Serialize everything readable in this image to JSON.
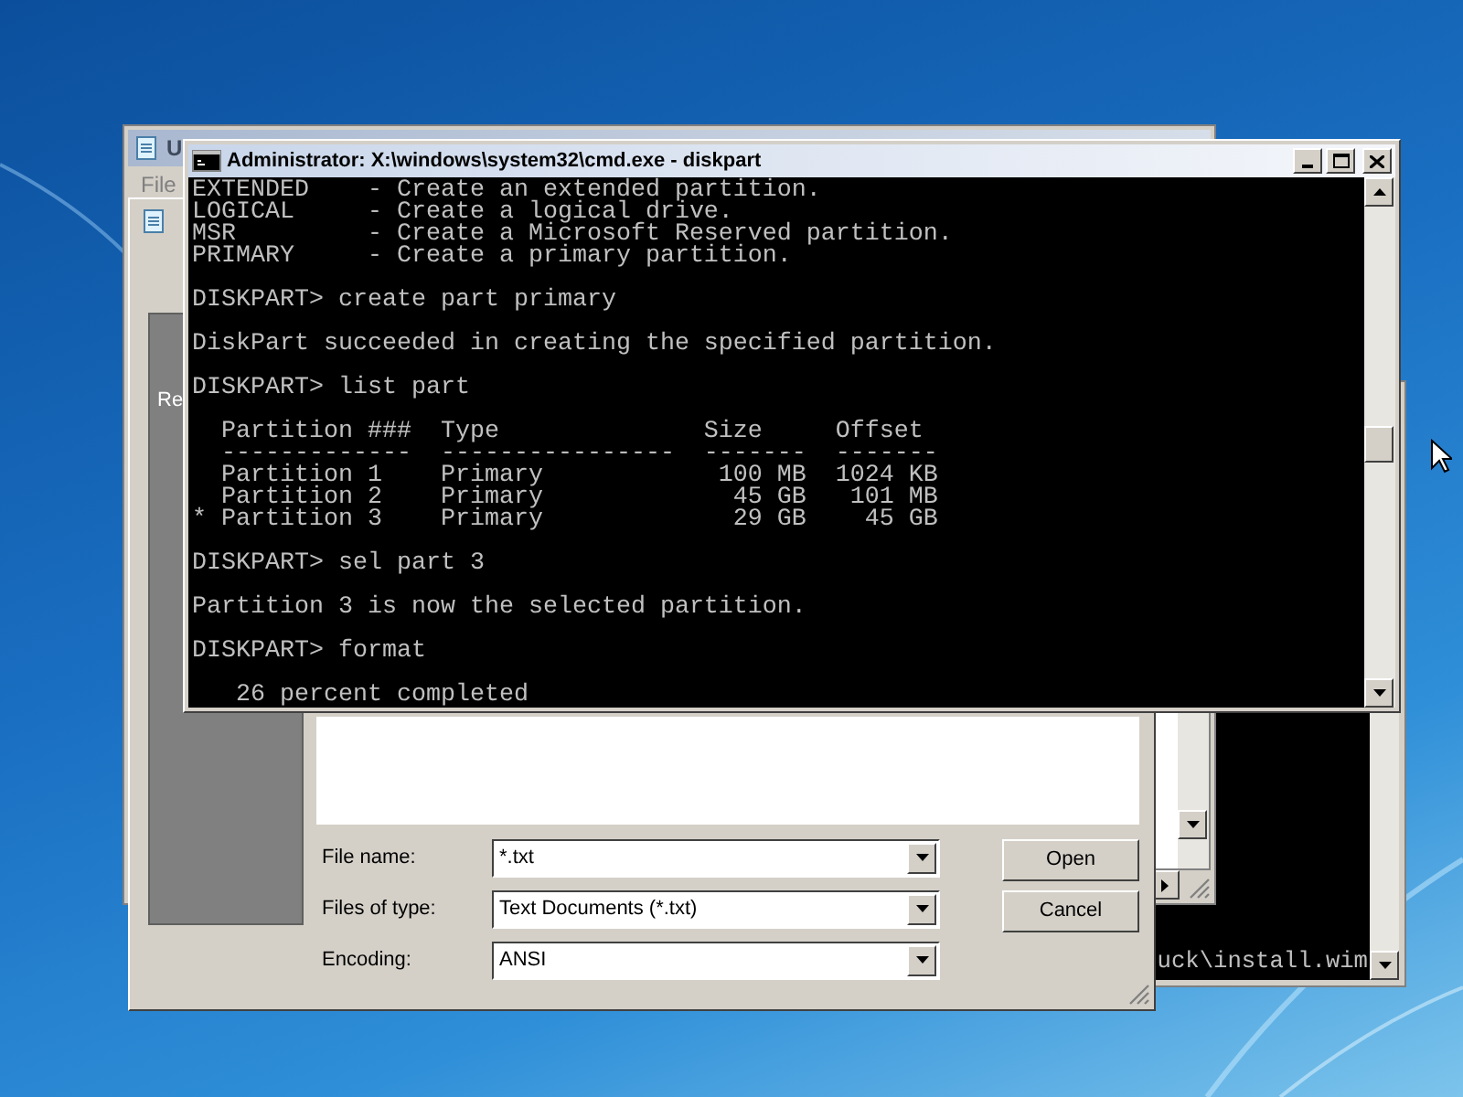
{
  "console_window_back": {
    "text": "uck\\install.wim"
  },
  "notepad_window": {
    "title": "U",
    "menu": [
      "File"
    ]
  },
  "open_dialog": {
    "places_item": "Re",
    "fields": [
      {
        "label": "File name:",
        "value": "*.txt"
      },
      {
        "label": "Files of type:",
        "value": "Text Documents (*.txt)"
      },
      {
        "label": "Encoding:",
        "value": "ANSI"
      }
    ],
    "buttons": [
      "Open",
      "Cancel"
    ]
  },
  "console_window": {
    "title": "Administrator: X:\\windows\\system32\\cmd.exe - diskpart",
    "text": "EXTENDED    - Create an extended partition.\nLOGICAL     - Create a logical drive.\nMSR         - Create a Microsoft Reserved partition.\nPRIMARY     - Create a primary partition.\n\nDISKPART> create part primary\n\nDiskPart succeeded in creating the specified partition.\n\nDISKPART> list part\n\n  Partition ###  Type              Size     Offset\n  -------------  ----------------  -------  -------\n  Partition 1    Primary            100 MB  1024 KB\n  Partition 2    Primary             45 GB   101 MB\n* Partition 3    Primary             29 GB    45 GB\n\nDISKPART> sel part 3\n\nPartition 3 is now the selected partition.\n\nDISKPART> format\n\n   26 percent completed"
  }
}
